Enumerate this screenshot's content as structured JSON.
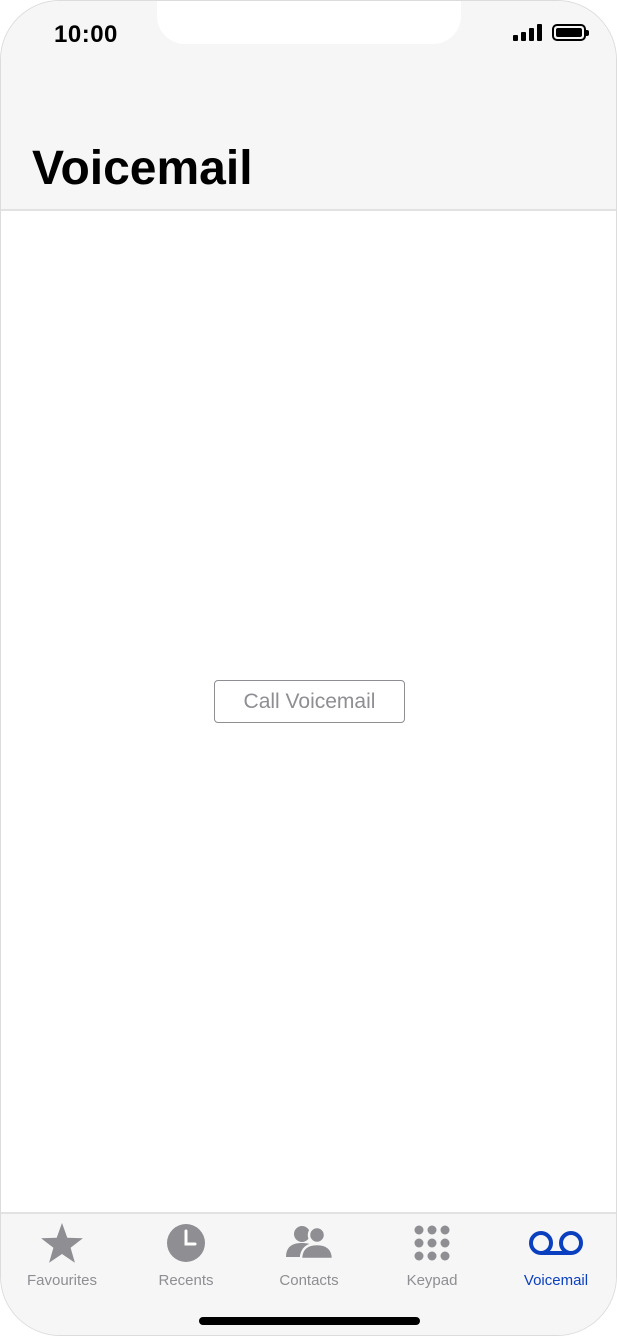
{
  "status_bar": {
    "time": "10:00",
    "signal_icon": "cellular-signal-icon",
    "battery_icon": "battery-icon"
  },
  "header": {
    "title": "Voicemail"
  },
  "main": {
    "call_voicemail_label": "Call Voicemail"
  },
  "tabbar": {
    "tabs": [
      {
        "label": "Favourites",
        "icon": "star-icon",
        "active": false
      },
      {
        "label": "Recents",
        "icon": "clock-icon",
        "active": false
      },
      {
        "label": "Contacts",
        "icon": "contacts-icon",
        "active": false
      },
      {
        "label": "Keypad",
        "icon": "keypad-icon",
        "active": false
      },
      {
        "label": "Voicemail",
        "icon": "voicemail-icon",
        "active": true
      }
    ]
  },
  "colors": {
    "accent": "#0a3fbf",
    "inactive": "#8e8e93",
    "bar_background": "#f6f6f6"
  }
}
